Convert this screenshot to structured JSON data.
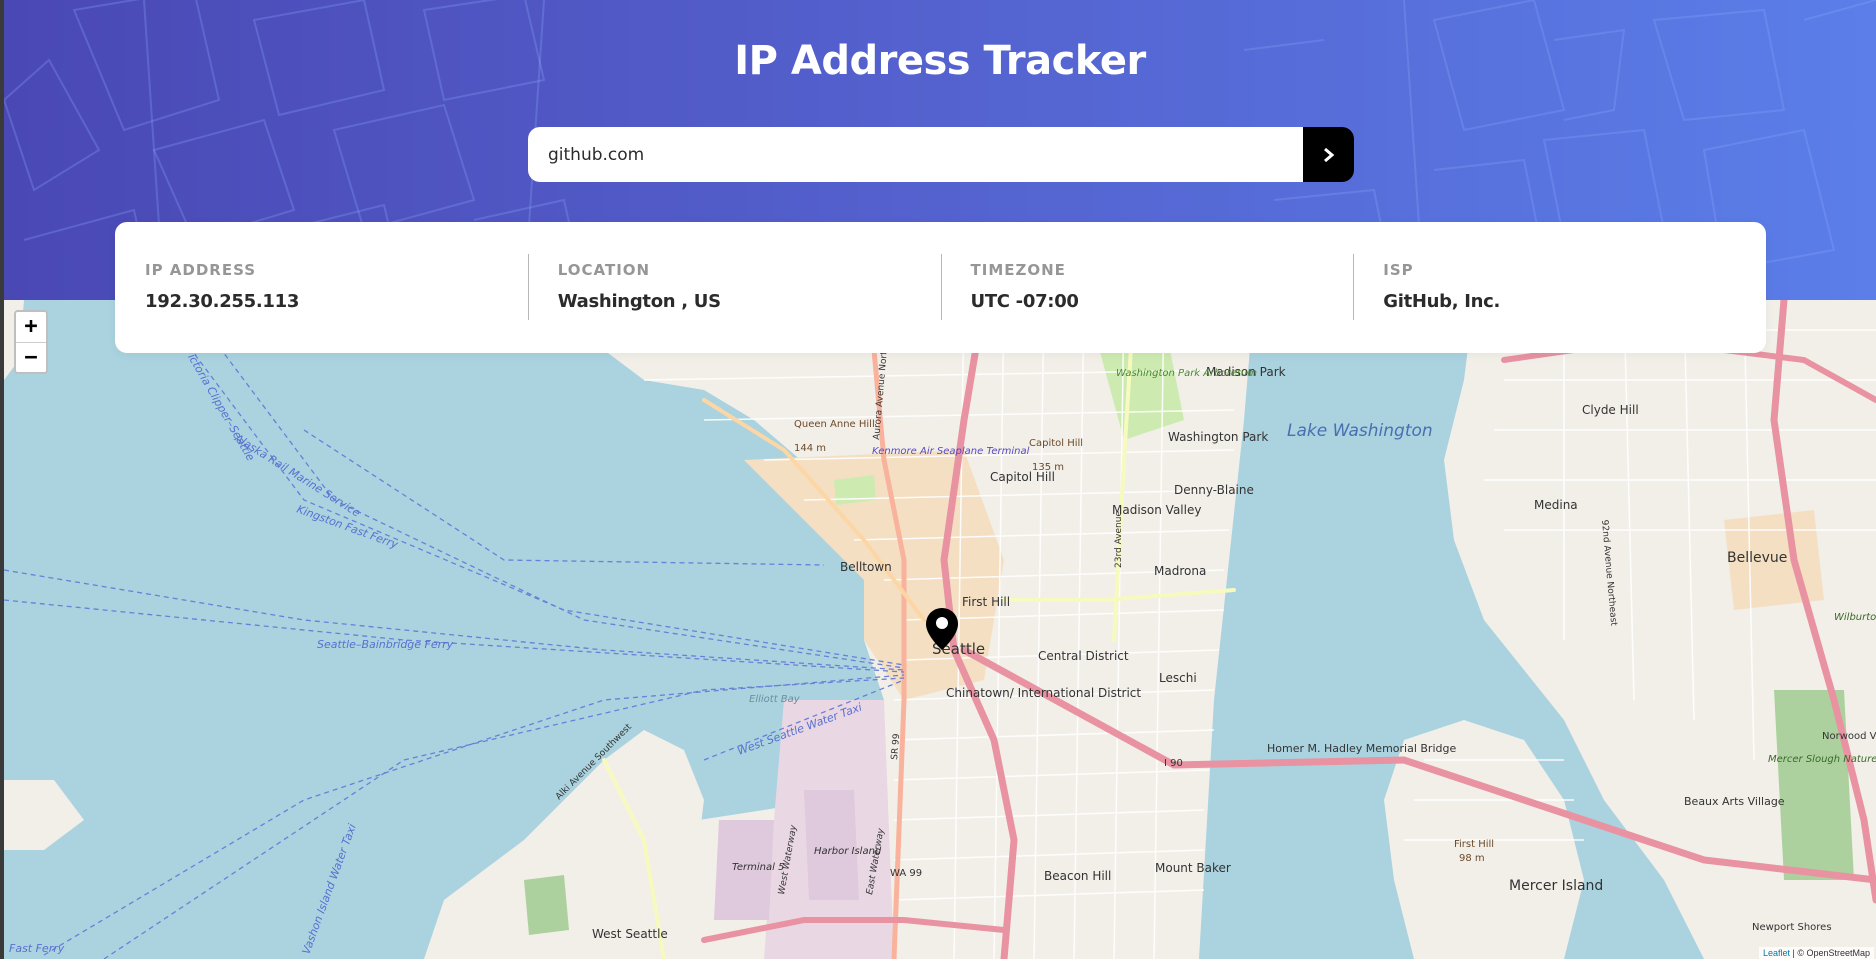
{
  "app": {
    "title": "IP Address Tracker"
  },
  "search": {
    "value": "github.com",
    "button_icon": "chevron-right-icon"
  },
  "info": {
    "ip_label": "IP ADDRESS",
    "ip_value": "192.30.255.113",
    "location_label": "LOCATION",
    "location_value": "Washington , US",
    "timezone_label": "TIMEZONE",
    "timezone_value": "UTC -07:00",
    "isp_label": "ISP",
    "isp_value": "GitHub, Inc."
  },
  "map": {
    "zoom_in": "+",
    "zoom_out": "−",
    "attribution_leaflet": "Leaflet",
    "attribution_osm": "© OpenStreetMap",
    "places": {
      "lake_washington": "Lake Washington",
      "madison_park": "Madison Park",
      "washington_park": "Washington Park",
      "washington_park_arboretum": "Washington Park Arboretum",
      "denny_blaine": "Denny-Blaine",
      "madison_valley": "Madison Valley",
      "madrona": "Madrona",
      "capitol_hill": "Capitol Hill",
      "capitol_hill_peak": "Capitol Hill",
      "capitol_hill_elev": "135 m",
      "queen_anne_hill": "Queen Anne Hill",
      "queen_anne_elev": "144 m",
      "kenmore_terminal": "Kenmore Air Seaplane Terminal",
      "belltown": "Belltown",
      "first_hill": "First Hill",
      "seattle": "Seattle",
      "central_district": "Central District",
      "chinatown": "Chinatown/ International District",
      "leschi": "Leschi",
      "clyde_hill": "Clyde Hill",
      "medina": "Medina",
      "bellevue": "Bellevue",
      "wilburton_hill_park": "Wilburton Hill Park",
      "norwood_village": "Norwood Village",
      "mercer_slough": "Mercer Slough Nature Park",
      "beaux_arts": "Beaux Arts Village",
      "mercer_island": "Mercer Island",
      "first_hill_mi": "First Hill",
      "first_hill_mi_elev": "98 m",
      "newport_shores": "Newport Shores",
      "homer_hadley": "Homer M. Hadley Memorial Bridge",
      "mount_baker": "Mount Baker",
      "beacon_hill": "Beacon Hill",
      "west_seattle": "West Seattle",
      "harbor_island": "Harbor Island",
      "terminal_5": "Terminal 5",
      "elliott_bay": "Elliott Bay",
      "west_waterway": "West Waterway",
      "east_waterway": "East Waterway",
      "seattle_bainbridge_ferry": "Seattle–Bainbridge Ferry",
      "kingston_fast_ferry": "Kingston Fast Ferry",
      "victoria_clipper": "Victoria Clipper–Seattle",
      "rail_marine_service": "Alaska Rail Marine Service",
      "west_seattle_water_taxi": "West Seattle Water Taxi",
      "vashon_water_taxi": "Vashon Island Water Taxi",
      "fast_ferry": "Fast Ferry",
      "alki_avenue": "Alki Avenue Southwest",
      "aurora_avenue": "Aurora Avenue North",
      "ave_23": "23rd Avenue",
      "ne_92": "92nd Avenue Northeast",
      "i90": "I 90",
      "wa99": "WA 99",
      "sr99": "SR 99"
    }
  }
}
